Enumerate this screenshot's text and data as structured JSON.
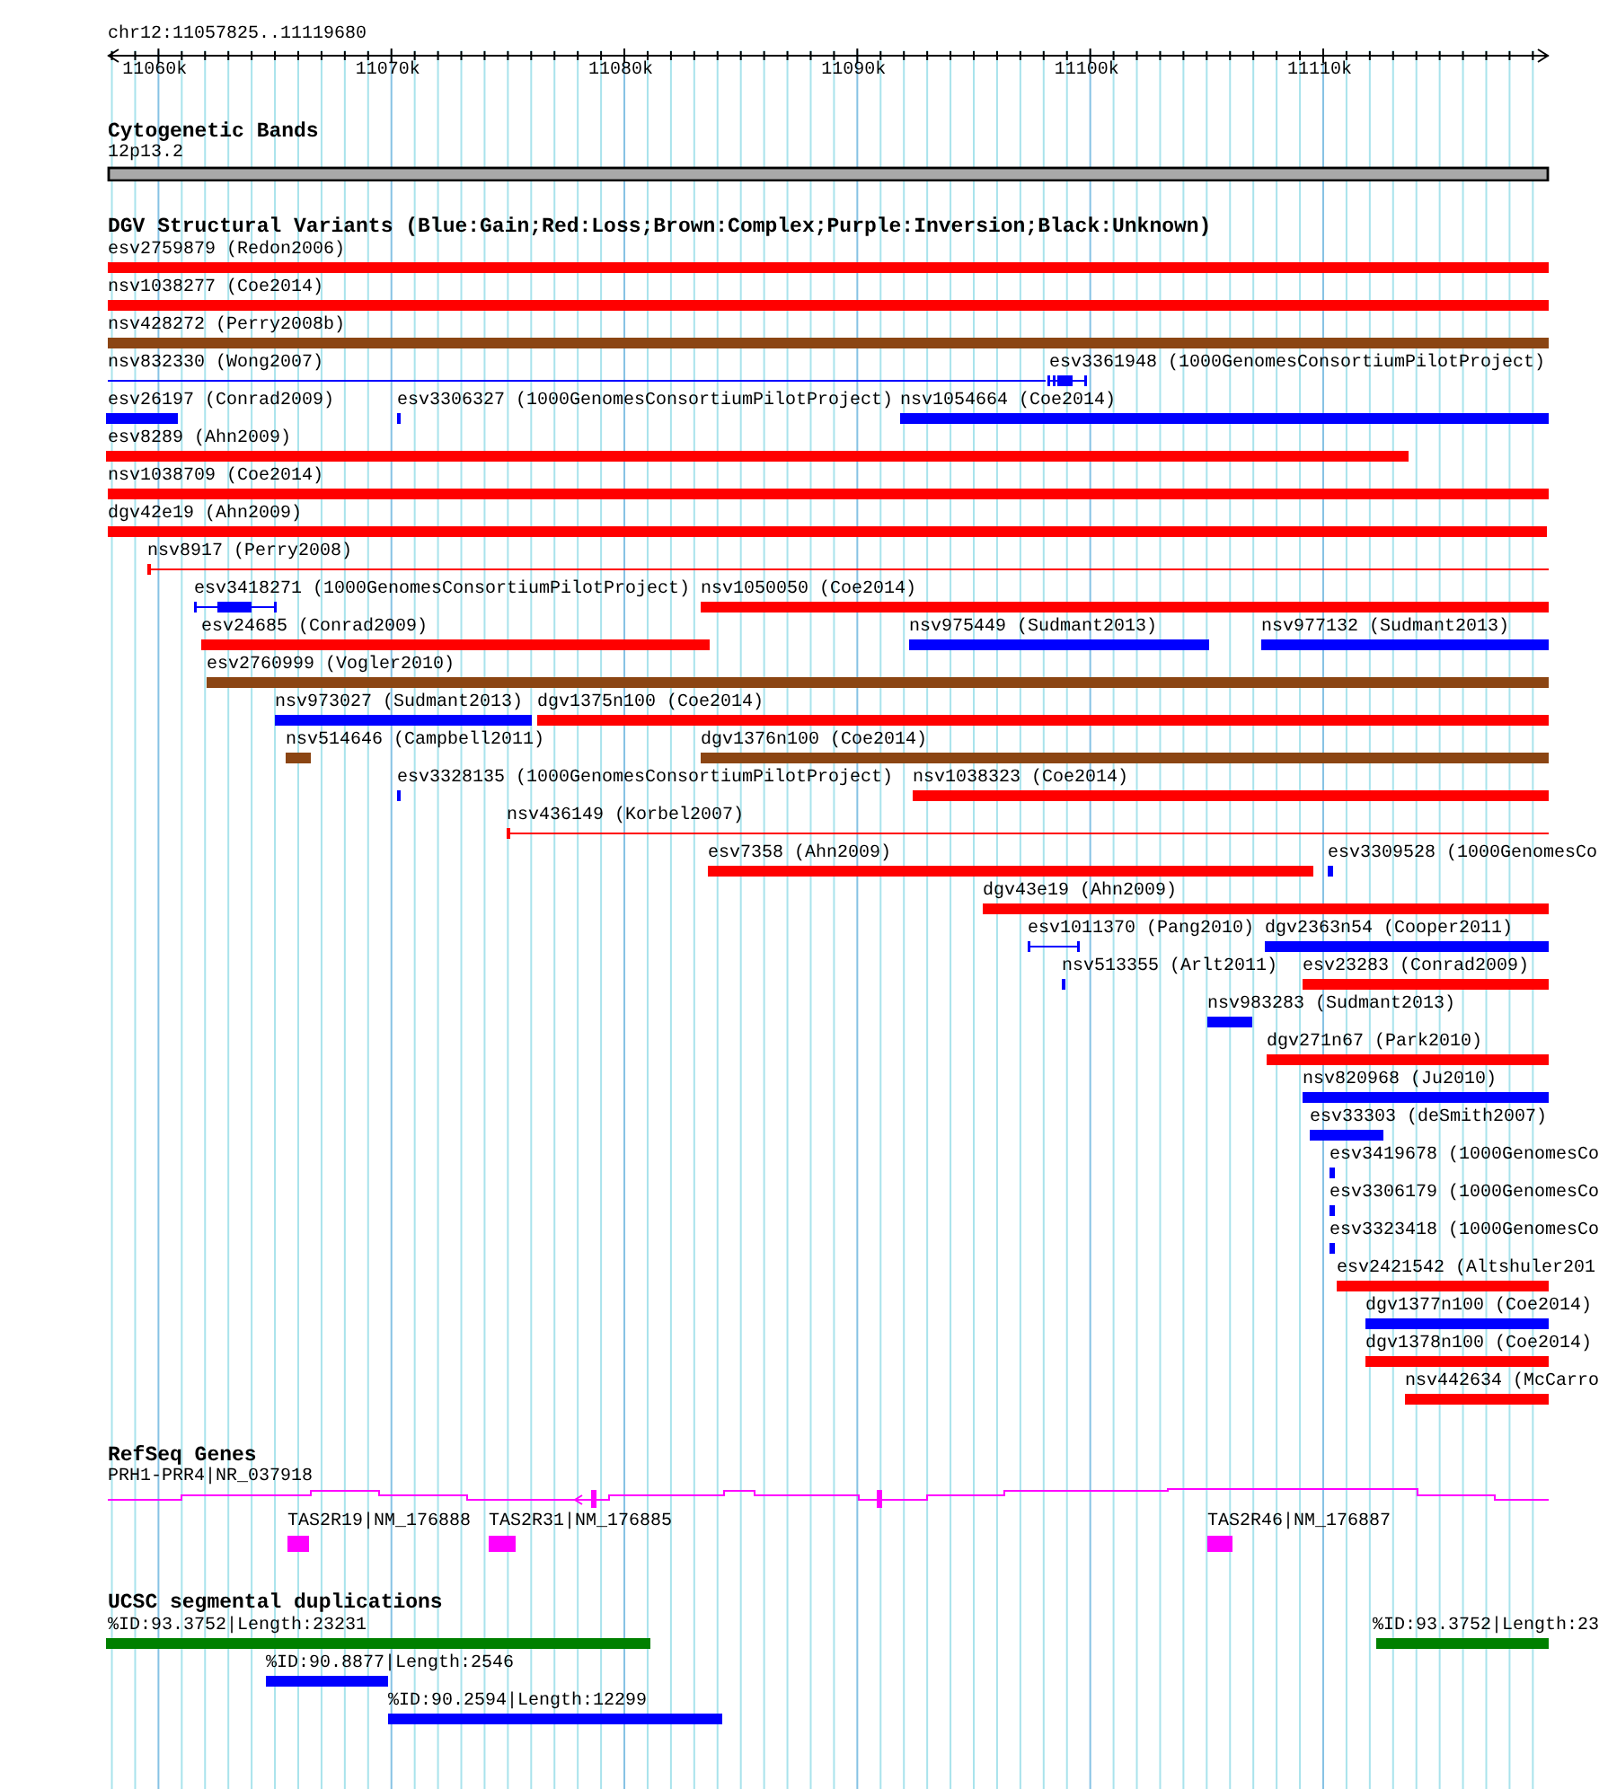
{
  "ruler": {
    "region": "chr12:11057825..11119680",
    "ticks": [
      "11060k",
      "11070k",
      "11080k",
      "11090k",
      "11100k",
      "11110k"
    ]
  },
  "cytogenetic_bands": {
    "title": "Cytogenetic Bands",
    "band": "12p13.2"
  },
  "dgv_structural_variants": {
    "title": "DGV Structural Variants (Blue:Gain;Red:Loss;Brown:Complex;Purple:Inversion;Black:Unknown)",
    "rows": [
      {
        "features": [
          {
            "label": "esv2759879 (Redon2006)",
            "color": "#ff0000",
            "kind": "bar"
          }
        ]
      },
      {
        "features": [
          {
            "label": "nsv1038277 (Coe2014)",
            "color": "#ff0000",
            "kind": "bar"
          }
        ]
      },
      {
        "features": [
          {
            "label": "nsv428272 (Perry2008b)",
            "color": "#8b4513",
            "kind": "bar"
          }
        ]
      },
      {
        "features": [
          {
            "label": "nsv832330 (Wong2007)",
            "color": "#0000ff",
            "kind": "line"
          },
          {
            "label": "esv3361948 (1000GenomesConsortiumPilotProject)",
            "color": "#0000ff",
            "kind": "line"
          }
        ]
      },
      {
        "features": [
          {
            "label": "esv26197 (Conrad2009)",
            "color": "#0000ff",
            "kind": "bar"
          },
          {
            "label": "esv3306327 (1000GenomesConsortiumPilotProject)",
            "color": "#0000ff",
            "kind": "bar"
          },
          {
            "label": "nsv1054664 (Coe2014)",
            "color": "#0000ff",
            "kind": "bar"
          }
        ]
      },
      {
        "features": [
          {
            "label": "esv8289 (Ahn2009)",
            "color": "#ff0000",
            "kind": "bar"
          }
        ]
      },
      {
        "features": [
          {
            "label": "nsv1038709 (Coe2014)",
            "color": "#ff0000",
            "kind": "bar"
          }
        ]
      },
      {
        "features": [
          {
            "label": "dgv42e19 (Ahn2009)",
            "color": "#ff0000",
            "kind": "bar"
          }
        ]
      },
      {
        "features": [
          {
            "label": "nsv8917 (Perry2008)",
            "color": "#ff0000",
            "kind": "line"
          }
        ]
      },
      {
        "features": [
          {
            "label": "esv3418271 (1000GenomesConsortiumPilotProject)",
            "color": "#0000ff",
            "kind": "line"
          },
          {
            "label": "nsv1050050 (Coe2014)",
            "color": "#ff0000",
            "kind": "bar"
          }
        ]
      },
      {
        "features": [
          {
            "label": "esv24685 (Conrad2009)",
            "color": "#ff0000",
            "kind": "bar"
          },
          {
            "label": "nsv975449 (Sudmant2013)",
            "color": "#0000ff",
            "kind": "bar"
          },
          {
            "label": "nsv977132 (Sudmant2013)",
            "color": "#0000ff",
            "kind": "bar"
          }
        ]
      },
      {
        "features": [
          {
            "label": "esv2760999 (Vogler2010)",
            "color": "#8b4513",
            "kind": "bar"
          }
        ]
      },
      {
        "features": [
          {
            "label": "nsv973027 (Sudmant2013)",
            "color": "#0000ff",
            "kind": "bar"
          },
          {
            "label": "dgv1375n100 (Coe2014)",
            "color": "#ff0000",
            "kind": "bar"
          }
        ]
      },
      {
        "features": [
          {
            "label": "nsv514646 (Campbell2011)",
            "color": "#8b4513",
            "kind": "bar"
          },
          {
            "label": "dgv1376n100 (Coe2014)",
            "color": "#8b4513",
            "kind": "bar"
          }
        ]
      },
      {
        "features": [
          {
            "label": "esv3328135 (1000GenomesConsortiumPilotProject)",
            "color": "#0000ff",
            "kind": "bar"
          },
          {
            "label": "nsv1038323 (Coe2014)",
            "color": "#ff0000",
            "kind": "bar"
          }
        ]
      },
      {
        "features": [
          {
            "label": "nsv436149 (Korbel2007)",
            "color": "#ff0000",
            "kind": "line"
          }
        ]
      },
      {
        "features": [
          {
            "label": "esv7358 (Ahn2009)",
            "color": "#ff0000",
            "kind": "bar"
          },
          {
            "label": "esv3309528 (1000GenomesCo",
            "color": "#0000ff",
            "kind": "bar"
          }
        ]
      },
      {
        "features": [
          {
            "label": "dgv43e19 (Ahn2009)",
            "color": "#ff0000",
            "kind": "bar"
          }
        ]
      },
      {
        "features": [
          {
            "label": "esv1011370 (Pang2010)",
            "color": "#0000ff",
            "kind": "line"
          },
          {
            "label": "dgv2363n54 (Cooper2011)",
            "color": "#0000ff",
            "kind": "bar"
          }
        ]
      },
      {
        "features": [
          {
            "label": "nsv513355 (Arlt2011)",
            "color": "#0000ff",
            "kind": "bar"
          },
          {
            "label": "esv23283 (Conrad2009)",
            "color": "#ff0000",
            "kind": "bar"
          }
        ]
      },
      {
        "features": [
          {
            "label": "nsv983283 (Sudmant2013)",
            "color": "#0000ff",
            "kind": "bar"
          }
        ]
      },
      {
        "features": [
          {
            "label": "dgv271n67 (Park2010)",
            "color": "#ff0000",
            "kind": "bar"
          }
        ]
      },
      {
        "features": [
          {
            "label": "nsv820968 (Ju2010)",
            "color": "#0000ff",
            "kind": "bar"
          }
        ]
      },
      {
        "features": [
          {
            "label": "esv33303 (deSmith2007)",
            "color": "#0000ff",
            "kind": "bar"
          }
        ]
      },
      {
        "features": [
          {
            "label": "esv3419678 (1000GenomesCo",
            "color": "#0000ff",
            "kind": "bar"
          }
        ]
      },
      {
        "features": [
          {
            "label": "esv3306179 (1000GenomesCo",
            "color": "#0000ff",
            "kind": "bar"
          }
        ]
      },
      {
        "features": [
          {
            "label": "esv3323418 (1000GenomesCo",
            "color": "#0000ff",
            "kind": "bar"
          }
        ]
      },
      {
        "features": [
          {
            "label": "esv2421542 (Altshuler201",
            "color": "#ff0000",
            "kind": "bar"
          }
        ]
      },
      {
        "features": [
          {
            "label": "dgv1377n100 (Coe2014)",
            "color": "#0000ff",
            "kind": "bar"
          }
        ]
      },
      {
        "features": [
          {
            "label": "dgv1378n100 (Coe2014)",
            "color": "#ff0000",
            "kind": "bar"
          }
        ]
      },
      {
        "features": [
          {
            "label": "nsv442634 (McCarro",
            "color": "#ff0000",
            "kind": "bar"
          }
        ]
      }
    ]
  },
  "refseq_genes": {
    "title": "RefSeq Genes",
    "rows": [
      {
        "features": [
          {
            "label": "PRH1-PRR4|NR_037918",
            "kind": "gene_model"
          }
        ]
      },
      {
        "features": [
          {
            "label": "TAS2R19|NM_176888",
            "kind": "block"
          },
          {
            "label": "TAS2R31|NM_176885",
            "kind": "block"
          },
          {
            "label": "TAS2R46|NM_176887",
            "kind": "block"
          }
        ]
      }
    ]
  },
  "ucsc_segmental_duplications": {
    "title": "UCSC segmental duplications",
    "rows": [
      {
        "features": [
          {
            "label": "%ID:93.3752|Length:23231",
            "color": "#008000"
          },
          {
            "label": "%ID:93.3752|Length:23",
            "color": "#008000"
          }
        ]
      },
      {
        "features": [
          {
            "label": "%ID:90.8877|Length:2546",
            "color": "#0000ff"
          }
        ]
      },
      {
        "features": [
          {
            "label": "%ID:90.2594|Length:12299",
            "color": "#0000ff"
          }
        ]
      }
    ]
  }
}
